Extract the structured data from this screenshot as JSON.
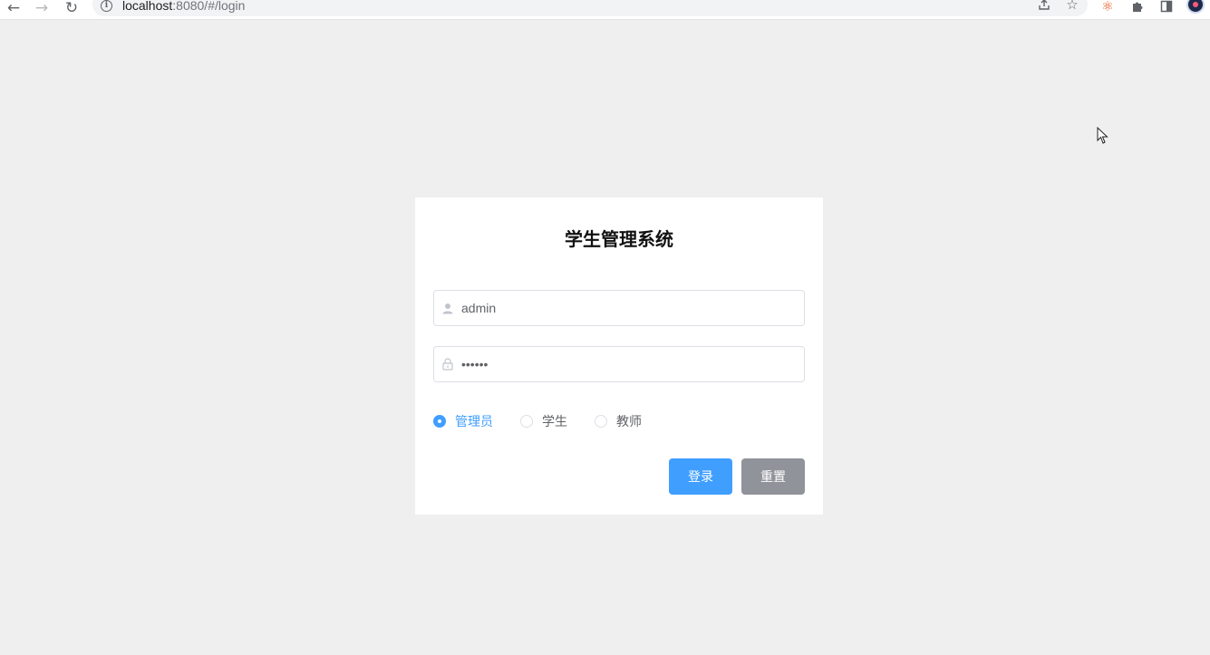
{
  "browser": {
    "url_host": "localhost",
    "url_rest": ":8080/#/login",
    "icons": {
      "back": "back-arrow-icon",
      "forward": "forward-arrow-icon",
      "reload": "reload-icon",
      "info": "info-icon",
      "share": "share-icon",
      "bookmark": "star-icon",
      "extension1": "orange-extension-icon",
      "extensions": "puzzle-icon",
      "sidepanel": "side-panel-icon",
      "profile": "profile-avatar-icon"
    }
  },
  "login": {
    "title": "学生管理系统",
    "username": {
      "value": "admin",
      "icon": "user-icon"
    },
    "password": {
      "value": "123456",
      "icon": "lock-icon"
    },
    "roles": [
      {
        "label": "管理员",
        "checked": true
      },
      {
        "label": "学生",
        "checked": false
      },
      {
        "label": "教师",
        "checked": false
      }
    ],
    "login_button": "登录",
    "reset_button": "重置"
  },
  "colors": {
    "primary": "#409eff",
    "reset": "#909399",
    "background": "#efefef"
  }
}
